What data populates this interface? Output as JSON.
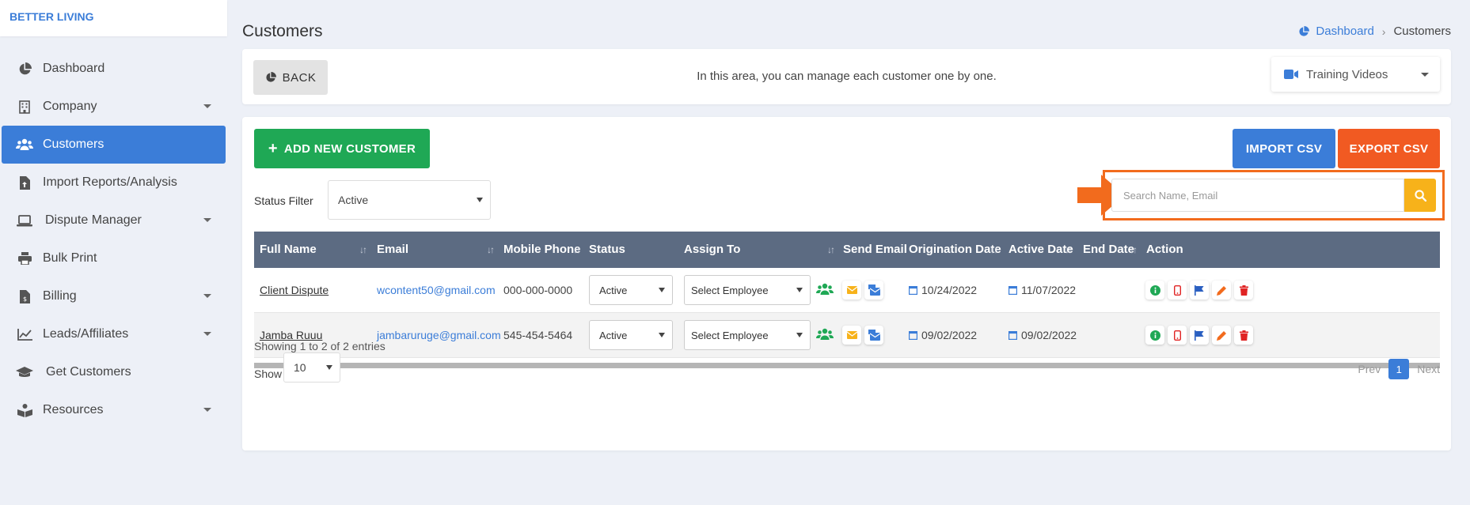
{
  "brand": "BETTER LIVING",
  "sidebar": {
    "items": [
      {
        "label": "Dashboard",
        "icon": "pie-chart-icon",
        "caret": false
      },
      {
        "label": "Company",
        "icon": "building-icon",
        "caret": true
      },
      {
        "label": "Customers",
        "icon": "users-icon",
        "caret": false,
        "active": true
      },
      {
        "label": "Import Reports/Analysis",
        "icon": "file-upload-icon",
        "caret": false
      },
      {
        "label": "Dispute Manager",
        "icon": "laptop-icon",
        "caret": true
      },
      {
        "label": "Bulk Print",
        "icon": "printer-icon",
        "caret": false
      },
      {
        "label": "Billing",
        "icon": "invoice-icon",
        "caret": true
      },
      {
        "label": "Leads/Affiliates",
        "icon": "line-chart-icon",
        "caret": true
      },
      {
        "label": "Get Customers",
        "icon": "graduation-cap-icon",
        "caret": false
      },
      {
        "label": "Resources",
        "icon": "book-reader-icon",
        "caret": true
      }
    ]
  },
  "header": {
    "title": "Customers",
    "breadcrumb": {
      "home": "Dashboard",
      "current": "Customers"
    }
  },
  "topbar": {
    "back_label": "BACK",
    "message": "In this area, you can manage each customer one by one.",
    "training_label": "Training Videos"
  },
  "toolbar": {
    "add_label": "ADD NEW CUSTOMER",
    "import_label": "IMPORT CSV",
    "export_label": "EXPORT CSV",
    "status_filter_label": "Status Filter",
    "status_filter_value": "Active",
    "search_placeholder": "Search Name, Email"
  },
  "table": {
    "columns": [
      "Full Name",
      "Email",
      "Mobile Phone",
      "Status",
      "Assign To",
      "Send Email",
      "Origination Date",
      "Active Date",
      "End Date",
      "Action"
    ],
    "rows": [
      {
        "name": "Client Dispute",
        "email": "wcontent50@gmail.com",
        "phone": "000-000-0000",
        "status": "Active",
        "assign": "Select Employee",
        "origination": "10/24/2022",
        "active": "11/07/2022",
        "end": ""
      },
      {
        "name": "Jamba Ruuu",
        "email": "jambaruruge@gmail.com",
        "phone": "545-454-5464",
        "status": "Active",
        "assign": "Select Employee",
        "origination": "09/02/2022",
        "active": "09/02/2022",
        "end": ""
      }
    ]
  },
  "footer": {
    "showing": "Showing 1 to 2 of 2 entries",
    "show_label": "Show",
    "page_size": "10",
    "prev": "Prev",
    "page": "1",
    "next": "Next"
  },
  "colors": {
    "primary": "#3b7dd8",
    "success": "#1fa855",
    "danger": "#f15a22",
    "warning": "#f7b21a",
    "highlight": "#f26b1d",
    "table_header": "#5c6b82"
  }
}
